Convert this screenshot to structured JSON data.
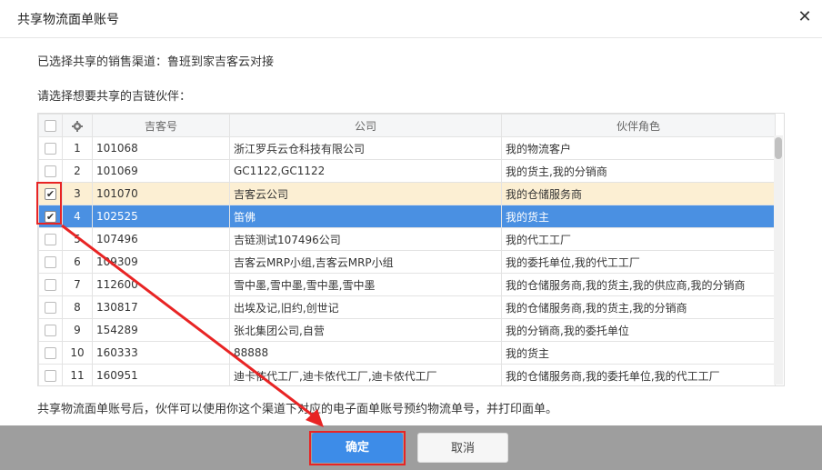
{
  "dialog": {
    "title": "共享物流面单账号",
    "close_glyph": "✕",
    "channel_line": "已选择共享的销售渠道：鲁班到家吉客云对接",
    "partner_prompt": "请选择想要共享的吉链伙伴：",
    "note": "共享物流面单账号后，伙伴可以使用你这个渠道下对应的电子面单账号预约物流单号，并打印面单。",
    "ok_label": "确定",
    "cancel_label": "取消",
    "accent_color": "#4a90e2",
    "highlight_color": "#e82424"
  },
  "table": {
    "headers": {
      "id": "吉客号",
      "company": "公司",
      "role": "伙伴角色",
      "settings_icon": "gear-icon"
    },
    "rows": [
      {
        "num": "1",
        "id": "101068",
        "company": "浙江罗兵云仓科技有限公司",
        "role": "我的物流客户",
        "checked": false,
        "state": "normal"
      },
      {
        "num": "2",
        "id": "101069",
        "company": "GC1122,GC1122",
        "role": "我的货主,我的分销商",
        "checked": false,
        "state": "normal"
      },
      {
        "num": "3",
        "id": "101070",
        "company": "吉客云公司",
        "role": "我的仓储服务商",
        "checked": true,
        "state": "yellow"
      },
      {
        "num": "4",
        "id": "102525",
        "company": "笛佛",
        "role": "我的货主",
        "checked": true,
        "state": "blue"
      },
      {
        "num": "5",
        "id": "107496",
        "company": "吉链测试107496公司",
        "role": "我的代工工厂",
        "checked": false,
        "state": "normal"
      },
      {
        "num": "6",
        "id": "109309",
        "company": "吉客云MRP小组,吉客云MRP小组",
        "role": "我的委托单位,我的代工工厂",
        "checked": false,
        "state": "normal"
      },
      {
        "num": "7",
        "id": "112600",
        "company": "雪中墨,雪中墨,雪中墨,雪中墨",
        "role": "我的仓储服务商,我的货主,我的供应商,我的分销商",
        "checked": false,
        "state": "normal"
      },
      {
        "num": "8",
        "id": "130817",
        "company": "出埃及记,旧约,创世记",
        "role": "我的仓储服务商,我的货主,我的分销商",
        "checked": false,
        "state": "normal"
      },
      {
        "num": "9",
        "id": "154289",
        "company": "张北集团公司,自营",
        "role": "我的分销商,我的委托单位",
        "checked": false,
        "state": "normal"
      },
      {
        "num": "10",
        "id": "160333",
        "company": "88888",
        "role": "我的货主",
        "checked": false,
        "state": "normal"
      },
      {
        "num": "11",
        "id": "160951",
        "company": "迪卡侬代工厂,迪卡侬代工厂,迪卡侬代工厂",
        "role": "我的仓储服务商,我的委托单位,我的代工工厂",
        "checked": false,
        "state": "normal"
      }
    ]
  }
}
